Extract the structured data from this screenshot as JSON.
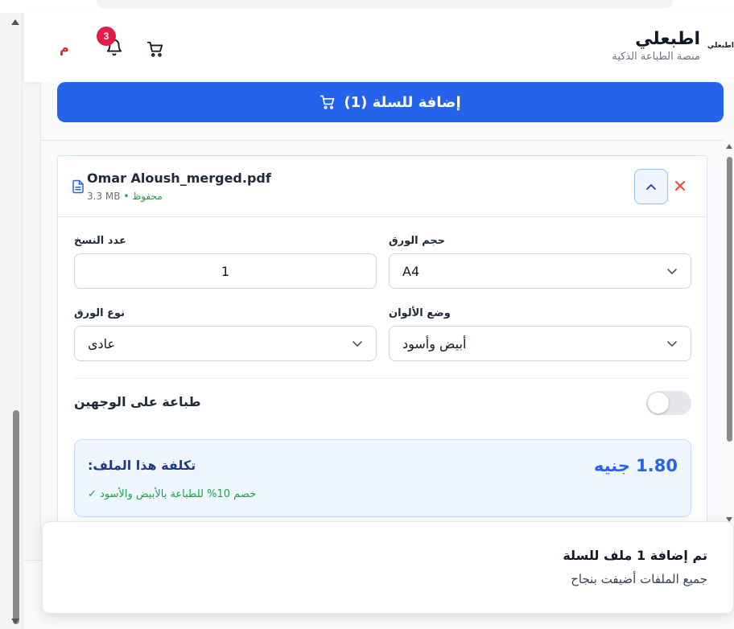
{
  "header": {
    "brand_title": "اطبعلي",
    "brand_subtitle": "منصة الطباعة الذكية",
    "brand_logo_text": "اطبعلي",
    "notification_count": "3",
    "user_initial": "م"
  },
  "actions": {
    "add_to_cart_label": "إضافة للسلة (1)"
  },
  "file": {
    "name": "Omar Aloush_merged.pdf",
    "size": "3.3 MB",
    "status": "محفوظ"
  },
  "form": {
    "copies_label": "عدد النسخ",
    "copies_value": "1",
    "paper_size_label": "حجم الورق",
    "paper_size_value": "A4",
    "paper_type_label": "نوع الورق",
    "paper_type_value": "عادى",
    "color_mode_label": "وضع الألوان",
    "color_mode_value": "أبيض وأسود",
    "duplex_label": "طباعة على الوجهين",
    "duplex_on": false
  },
  "cost": {
    "label": "تكلفة هذا الملف:",
    "value": "1.80 جنيه",
    "discount_note": "خصم 10% للطباعة بالأبيض والأسود ✓"
  },
  "toast": {
    "title": "تم إضافة 1 ملف للسلة",
    "description": "جميع الملفات أضيفت بنجاح"
  },
  "colors": {
    "primary": "#2563eb",
    "success": "#16a34a",
    "danger": "#dc2626",
    "badge": "#e11d48"
  }
}
